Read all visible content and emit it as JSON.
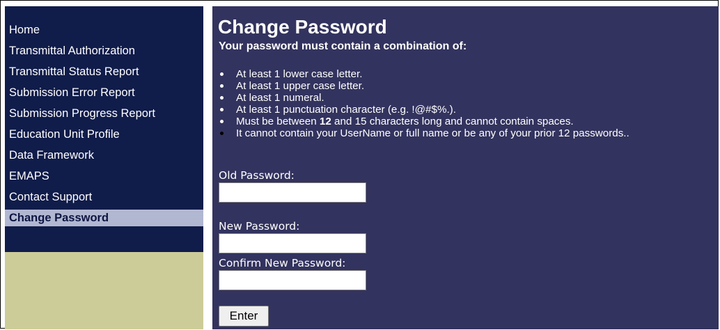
{
  "nav": {
    "items": [
      {
        "label": "Home"
      },
      {
        "label": "Transmittal Authorization"
      },
      {
        "label": "Transmittal Status Report"
      },
      {
        "label": "Submission Error Report"
      },
      {
        "label": "Submission Progress Report"
      },
      {
        "label": "Education Unit Profile"
      },
      {
        "label": "Data Framework"
      },
      {
        "label": "EMAPS"
      },
      {
        "label": "Contact Support"
      },
      {
        "label": "Change Password",
        "active": true
      }
    ]
  },
  "main": {
    "title": "Change Password",
    "subtitle": "Your password must contain a combination of:",
    "rules": [
      "At least 1 lower case letter.",
      "At least 1 upper case letter.",
      "At least 1 numeral.",
      "At least 1 punctuation character (e.g. !@#$%.).",
      {
        "before": "Must be between ",
        "bold": "12",
        "after": " and 15 characters long and cannot contain spaces."
      },
      "It cannot contain your UserName or full name or be any of your prior 12 passwords.."
    ],
    "old_password_label": "Old Password:",
    "new_password_label": "New Password:",
    "confirm_password_label": "Confirm New Password:",
    "old_password_value": "",
    "new_password_value": "",
    "confirm_password_value": "",
    "submit_label": "Enter"
  },
  "colors": {
    "nav_bg": "#101c4a",
    "main_bg": "#33335f",
    "sidebar_filler": "#cccc99",
    "active_item": "#c3c8dc"
  }
}
